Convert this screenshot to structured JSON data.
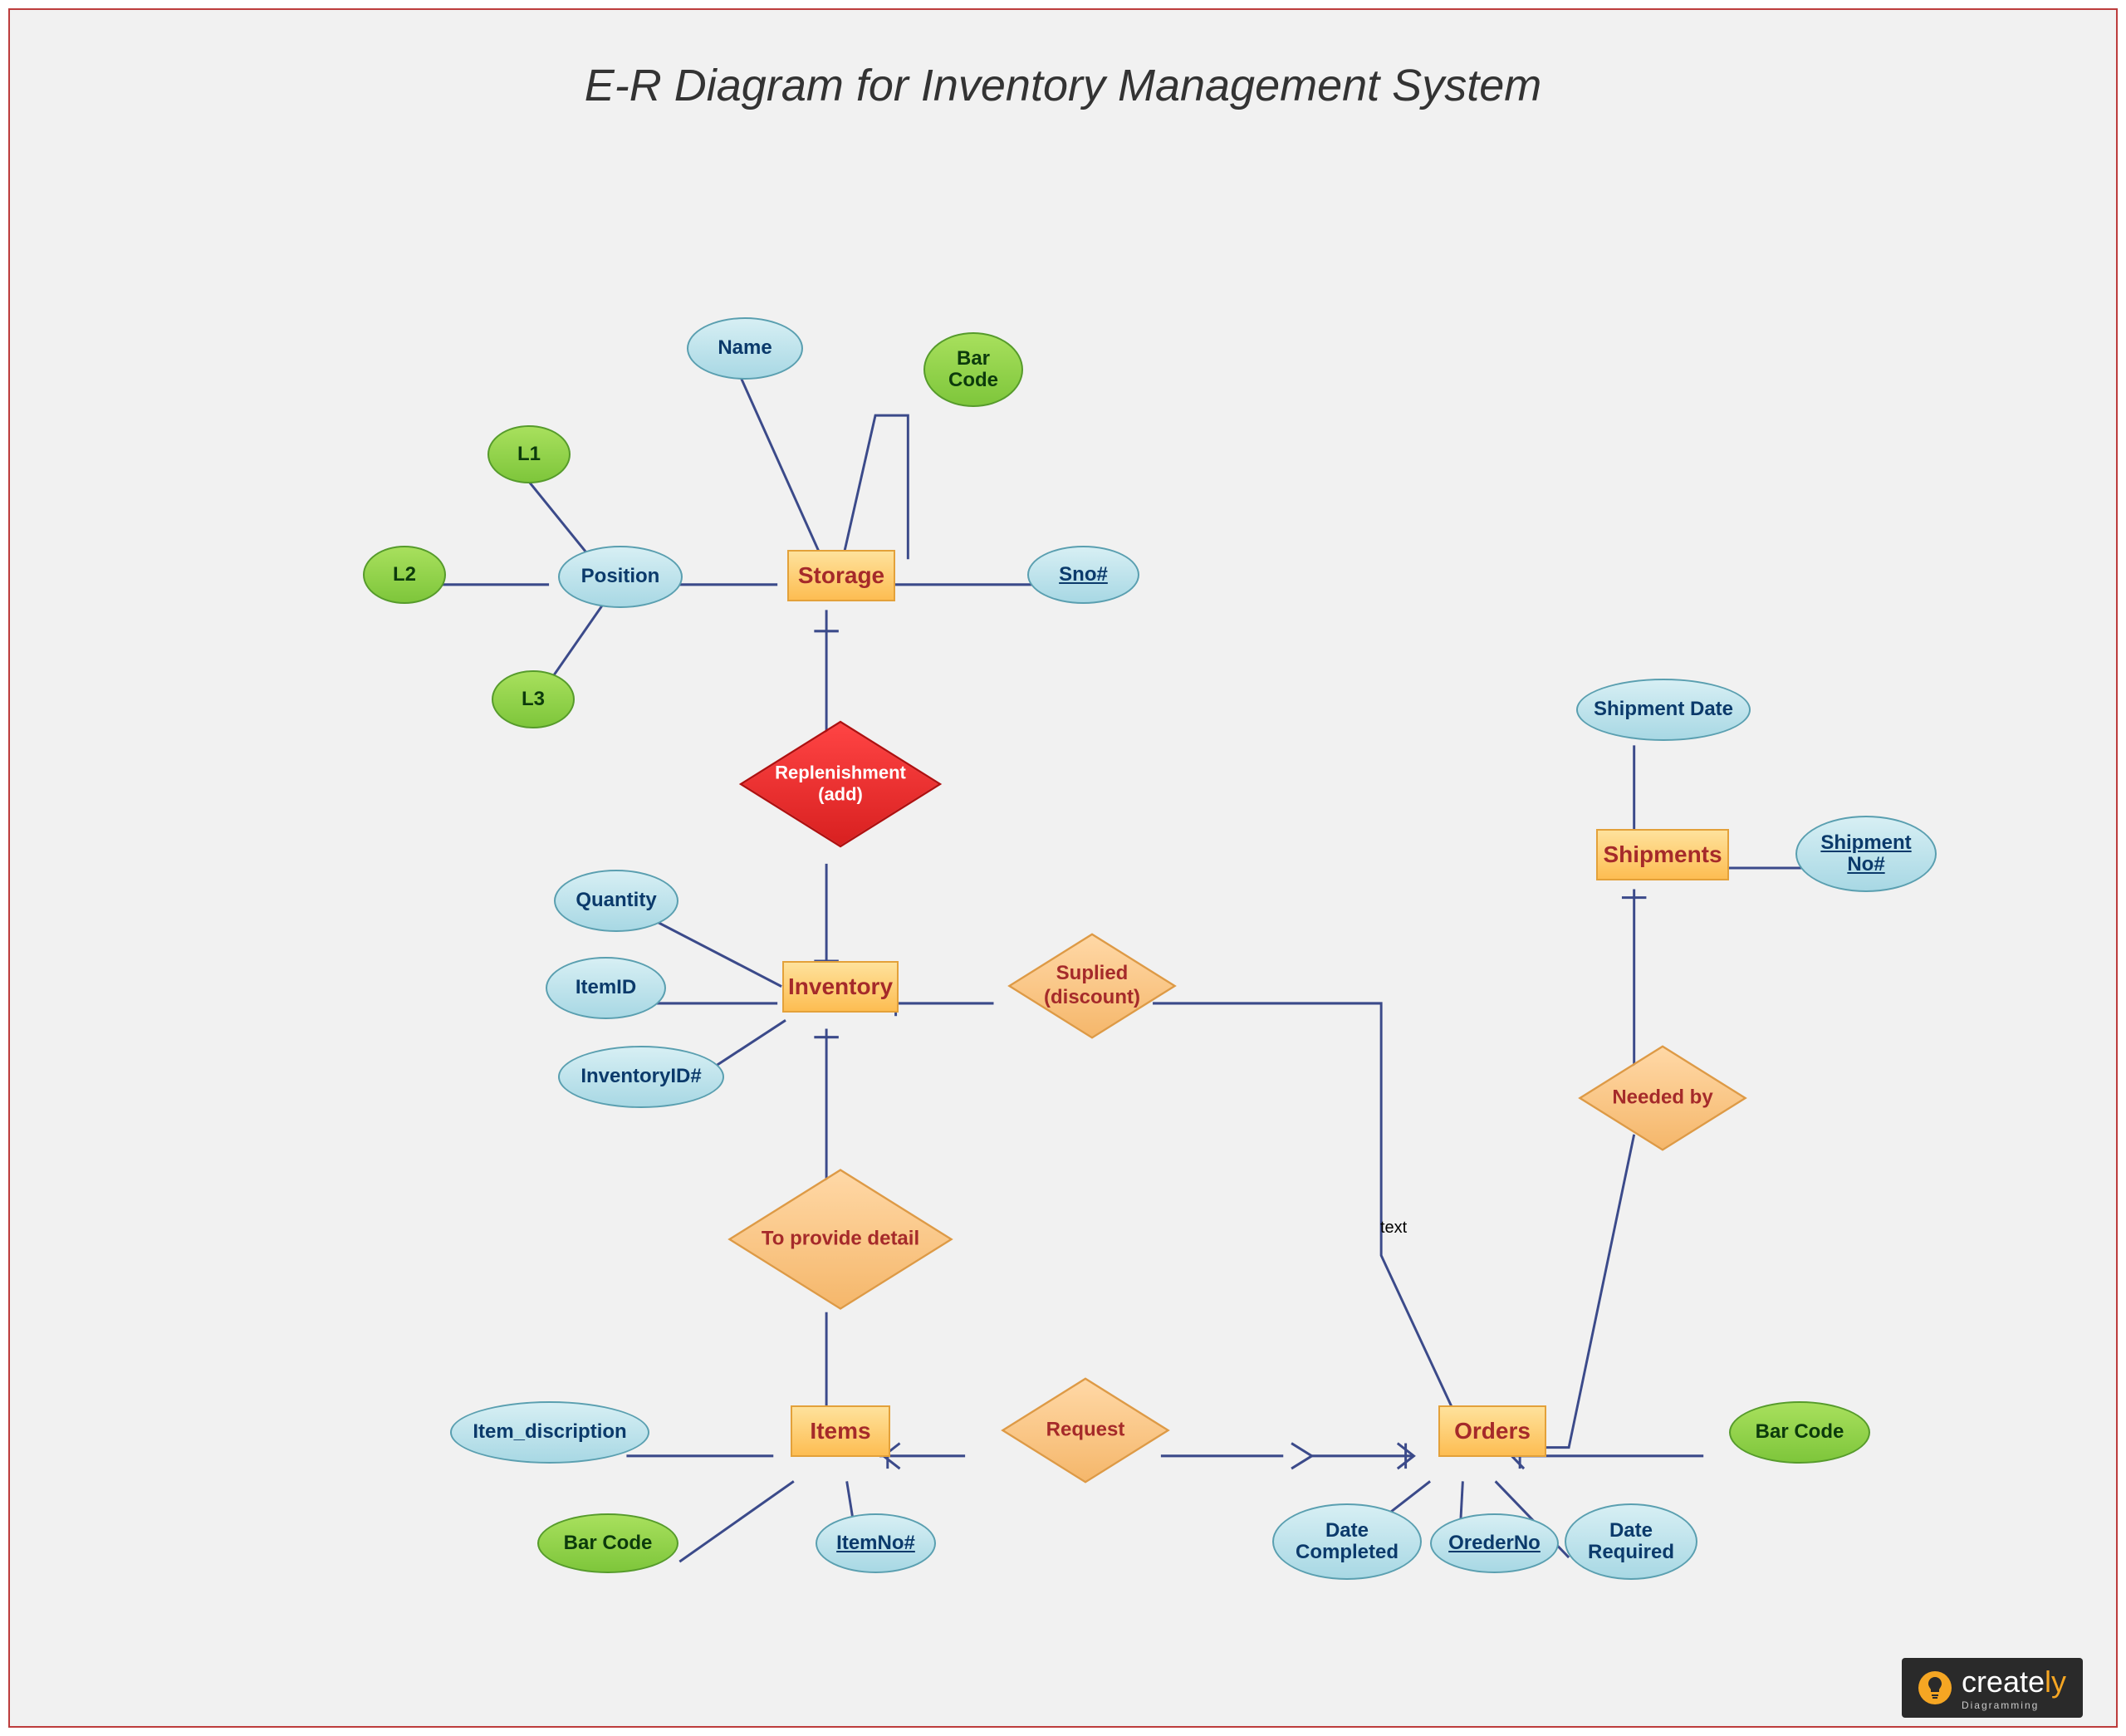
{
  "title": "E-R Diagram for Inventory Management System",
  "entities": {
    "storage": "Storage",
    "inventory": "Inventory",
    "items": "Items",
    "orders": "Orders",
    "shipments": "Shipments"
  },
  "attributes": {
    "blue": {
      "name": "Name",
      "position": "Position",
      "sno": "Sno#",
      "quantity": "Quantity",
      "itemid": "ItemID",
      "inventoryid": "InventoryID#",
      "item_discription": "Item_discription",
      "itemno": "ItemNo#",
      "date_completed": "Date\nCompleted",
      "orederno": "OrederNo",
      "date_required": "Date\nRequired",
      "shipment_date": "Shipment Date",
      "shipment_no": "Shipment\nNo#"
    },
    "green": {
      "barcode_storage": "Bar\nCode",
      "l1": "L1",
      "l2": "L2",
      "l3": "L3",
      "barcode_items": "Bar Code",
      "barcode_orders": "Bar Code"
    }
  },
  "relationships": {
    "replenishment": "Replenishment\n(add)",
    "suplied": "Suplied\n(discount)",
    "to_provide_detail": "To provide detail",
    "request": "Request",
    "needed_by": "Needed by"
  },
  "labels": {
    "text": "text"
  },
  "brand": {
    "name": "create",
    "suffix": "ly",
    "sub": "Diagramming"
  }
}
